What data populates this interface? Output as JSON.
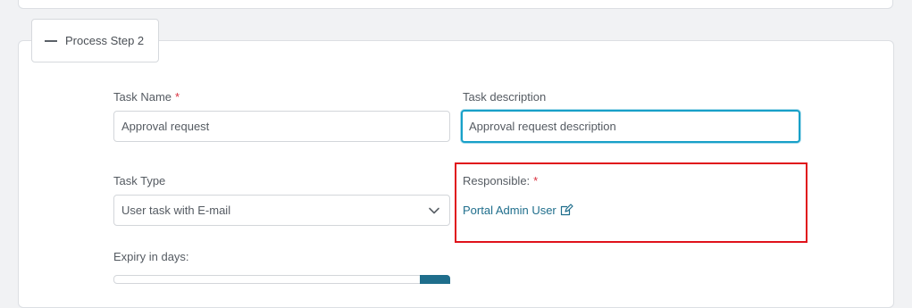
{
  "step": {
    "title": "Process Step 2",
    "toggle_icon": "minus-icon"
  },
  "fields": {
    "task_name": {
      "label": "Task Name",
      "required_marker": "*",
      "value": "Approval request"
    },
    "task_description": {
      "label": "Task description",
      "value": "Approval request description"
    },
    "task_type": {
      "label": "Task Type",
      "selected": "User task with E-mail"
    },
    "responsible": {
      "label": "Responsible:",
      "required_marker": "*",
      "value": "Portal Admin User",
      "icon": "edit-icon"
    },
    "expiry": {
      "label": "Expiry in days:"
    }
  },
  "colors": {
    "required": "#d9303e",
    "link": "#1f6e8c",
    "focus": "#17a0c8",
    "highlight": "#e0121b"
  }
}
